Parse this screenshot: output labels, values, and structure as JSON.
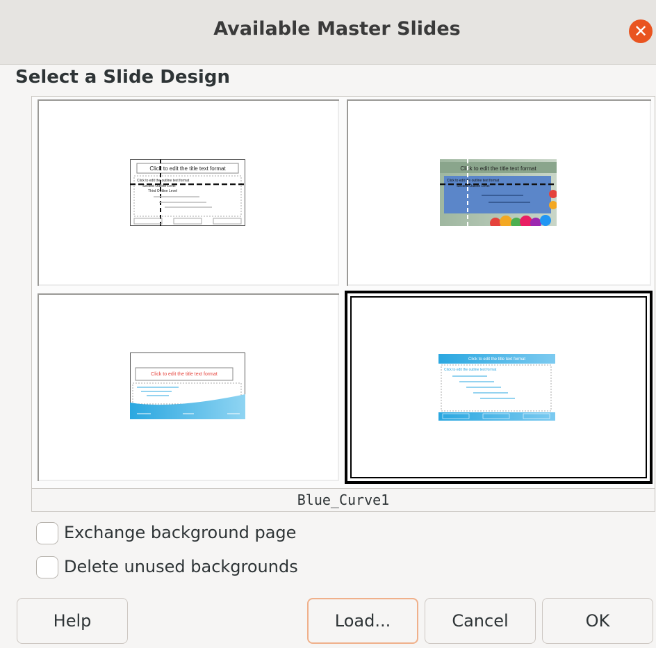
{
  "dialog": {
    "title": "Available Master Slides",
    "close_icon": "close-icon",
    "accent_color": "#e95420"
  },
  "section": {
    "heading": "Select a Slide Design"
  },
  "designs": {
    "selected_name": "Blue_Curve1",
    "thumbnails": [
      {
        "title_text": "Click to edit the title text format",
        "outline_text": "Click to edit the outline text format",
        "level2": "Second Outline Level",
        "level3": "Third Outline Level"
      },
      {
        "title_text": "Click to edit the title text format",
        "outline_text": "Click to edit the outline text format",
        "level2": "Second Outline Level"
      },
      {
        "title_text": "Click to edit the title text format"
      },
      {
        "title_text": "Click to edit the title text format",
        "outline_text": "Click to edit the outline text format"
      }
    ]
  },
  "options": {
    "exchange_background": {
      "label": "Exchange background page",
      "checked": false
    },
    "delete_unused": {
      "label": "Delete unused backgrounds",
      "checked": false
    }
  },
  "buttons": {
    "help": "Help",
    "load": "Load...",
    "cancel": "Cancel",
    "ok": "OK"
  }
}
